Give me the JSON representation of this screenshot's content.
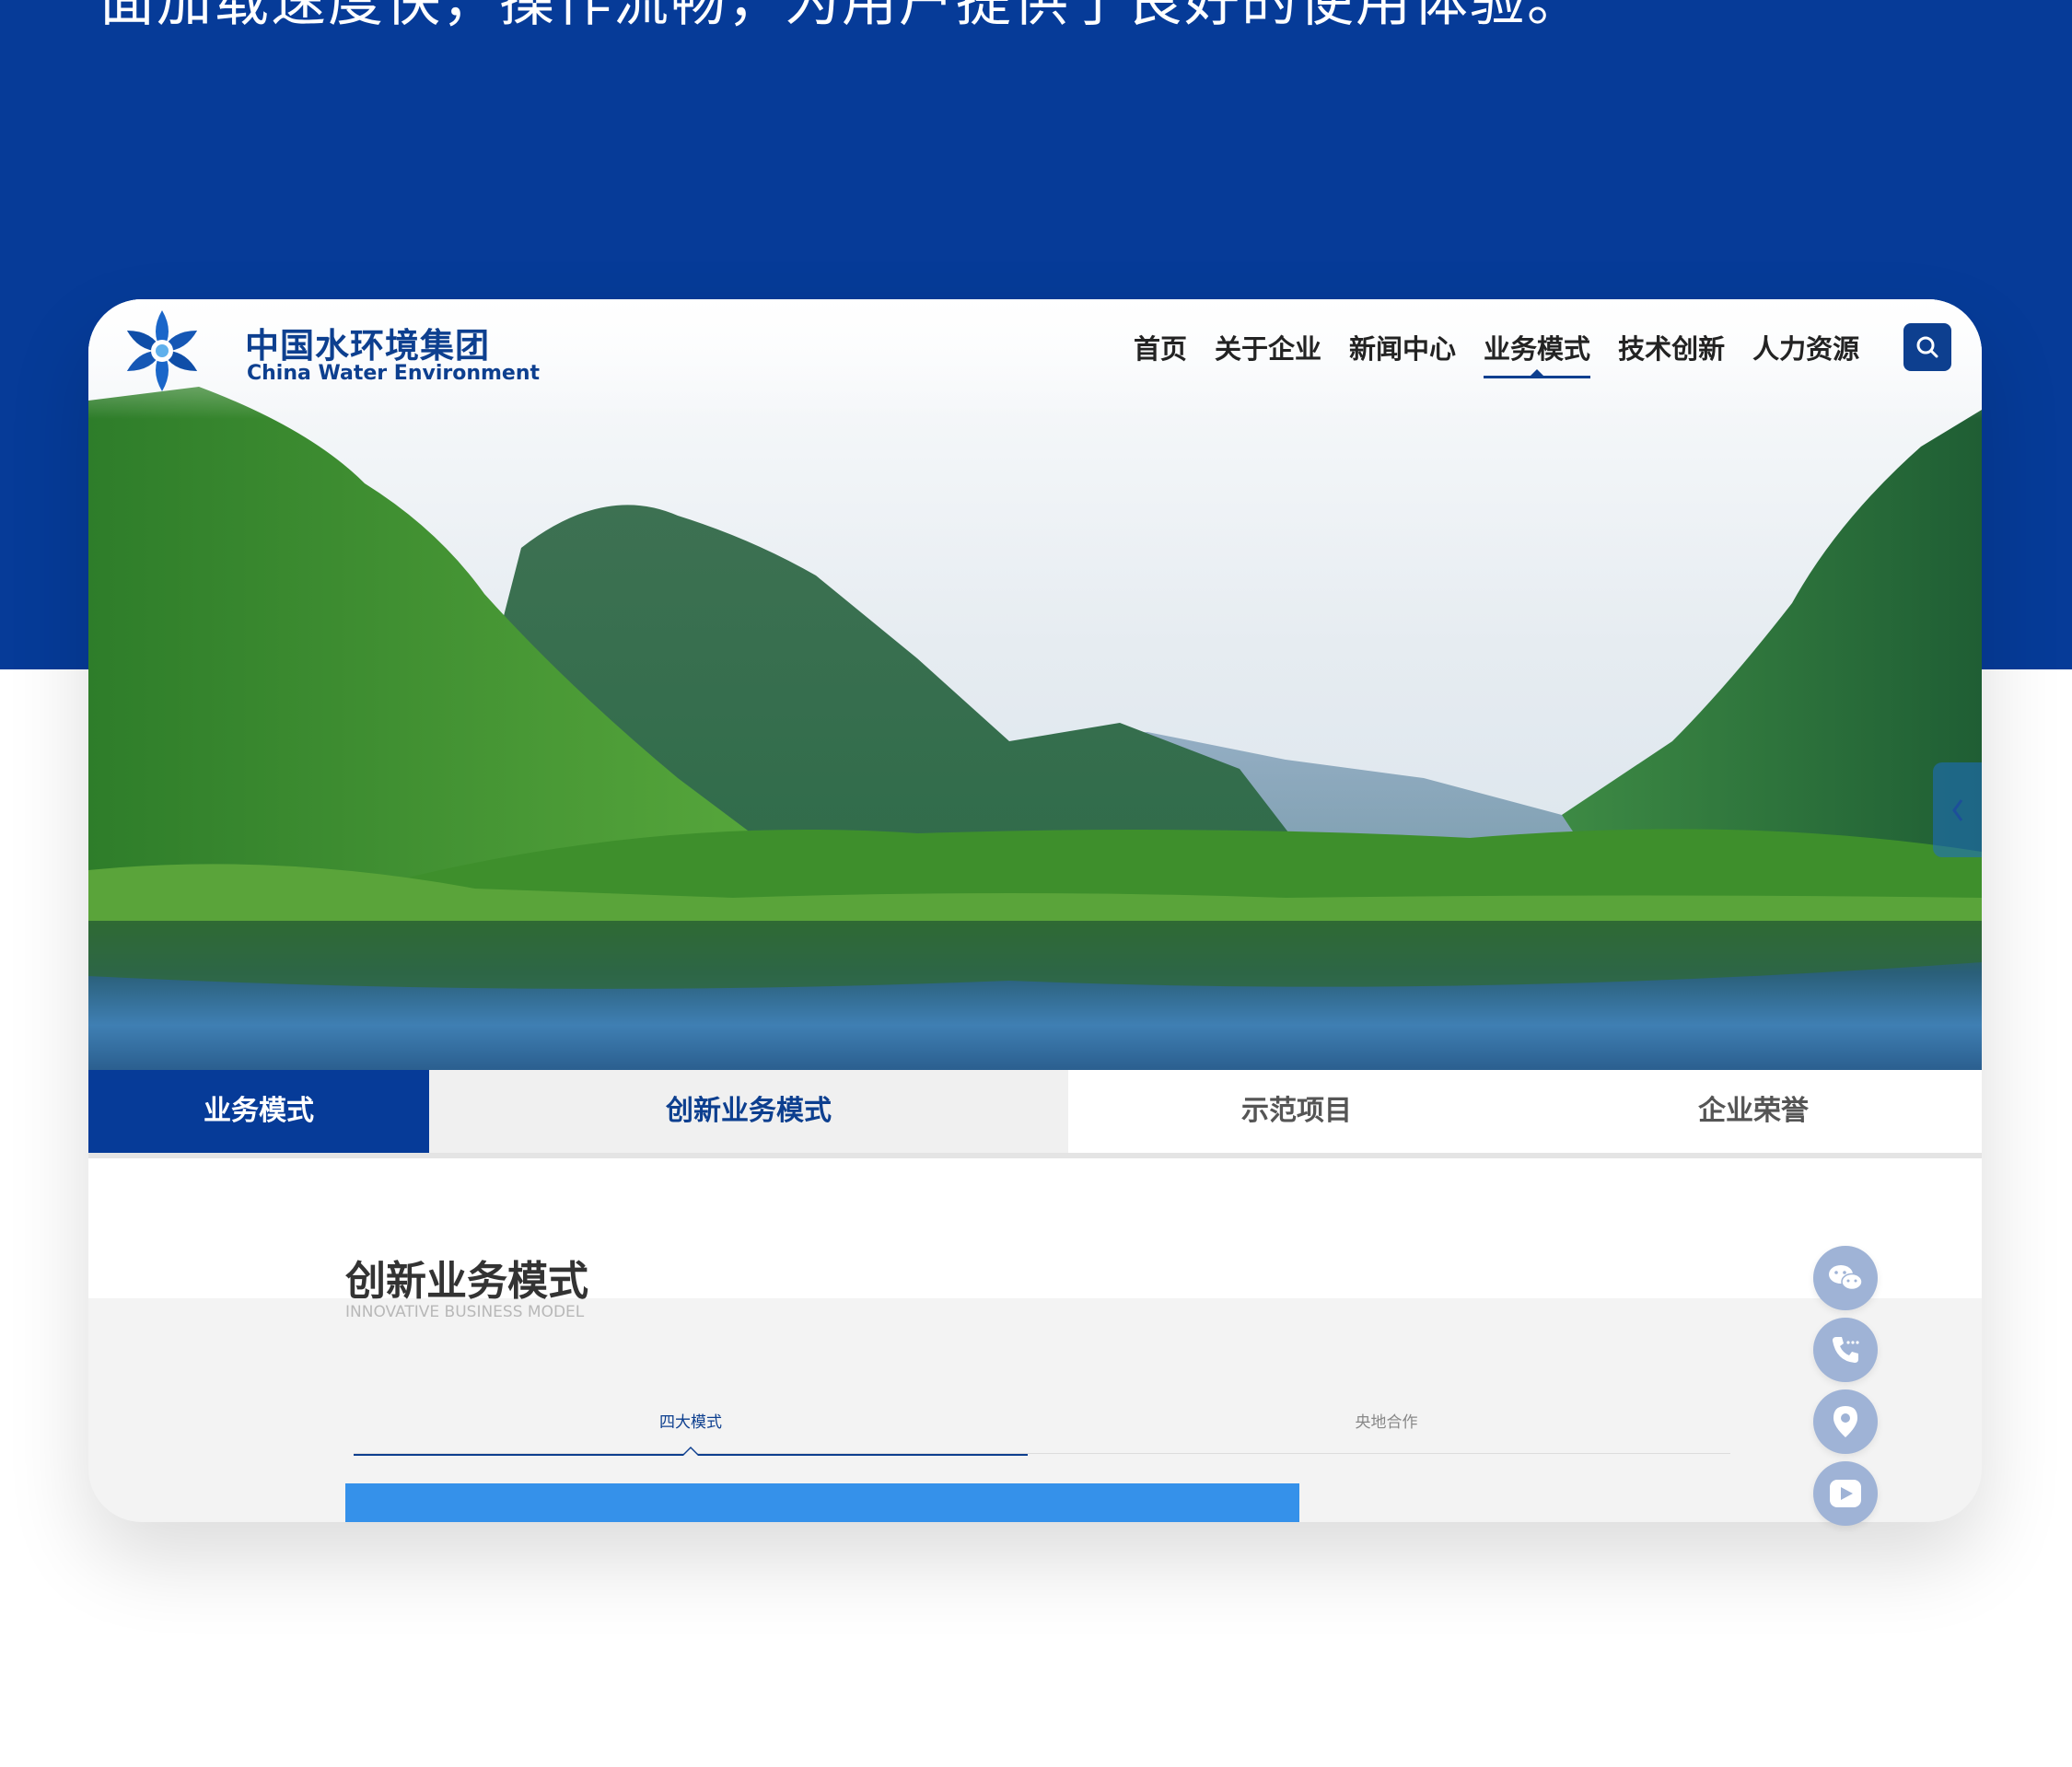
{
  "headline": "面加载速度快，操作流畅，为用户提供了良好的使用体验。",
  "logo": {
    "name_cn": "中国水环境集团",
    "name_en": "China Water Environment"
  },
  "nav": {
    "items": [
      {
        "label": "首页"
      },
      {
        "label": "关于企业"
      },
      {
        "label": "新闻中心"
      },
      {
        "label": "业务模式",
        "active": true
      },
      {
        "label": "技术创新"
      },
      {
        "label": "人力资源"
      }
    ],
    "search_icon": "search-icon"
  },
  "hero": {
    "side_arrow": "《"
  },
  "subnav": {
    "title": "业务模式",
    "tabs": [
      {
        "label": "创新业务模式",
        "active": true
      },
      {
        "label": "示范项目"
      },
      {
        "label": "企业荣誉"
      }
    ]
  },
  "section": {
    "title": "创新业务模式",
    "subtitle": "INNOVATIVE BUSINESS MODEL",
    "tabs": [
      {
        "label": "四大模式",
        "active": true
      },
      {
        "label": "央地合作"
      }
    ]
  },
  "float_buttons": [
    "wechat-icon",
    "phone-icon",
    "location-icon",
    "video-icon"
  ],
  "colors": {
    "brand_blue": "#063b98",
    "nav_blue": "#0d3f8f",
    "accent_blue": "#3591ea",
    "float_button": "#9fb3d6"
  }
}
